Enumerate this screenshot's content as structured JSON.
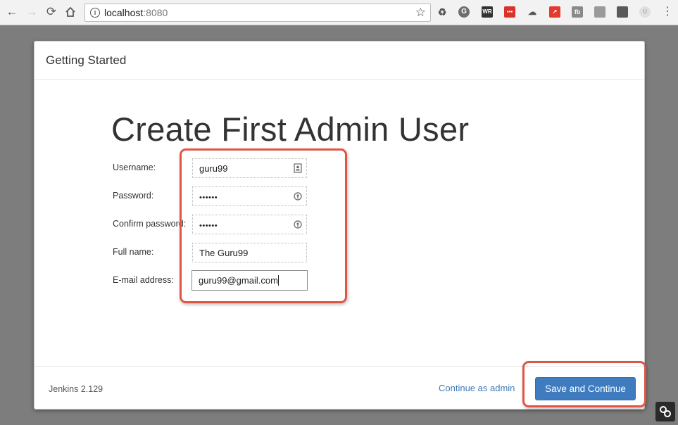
{
  "browser": {
    "url_host": "localhost",
    "url_port": ":8080"
  },
  "modal": {
    "title": "Getting Started",
    "heading": "Create First Admin User"
  },
  "form": {
    "fields": [
      {
        "label": "Username:",
        "value": "guru99",
        "type": "text"
      },
      {
        "label": "Password:",
        "value": "••••••",
        "type": "password"
      },
      {
        "label": "Confirm password:",
        "value": "••••••",
        "type": "password"
      },
      {
        "label": "Full name:",
        "value": "The Guru99",
        "type": "text"
      },
      {
        "label": "E-mail address:",
        "value": "guru99@gmail.com",
        "type": "text"
      }
    ]
  },
  "footer": {
    "version": "Jenkins 2.129",
    "continue_label": "Continue as admin",
    "save_label": "Save and Continue"
  },
  "extensions": {
    "wr_label": "WR",
    "fb_label": "fb"
  },
  "colors": {
    "accent": "#3e7cbf",
    "highlight": "#e05545"
  }
}
